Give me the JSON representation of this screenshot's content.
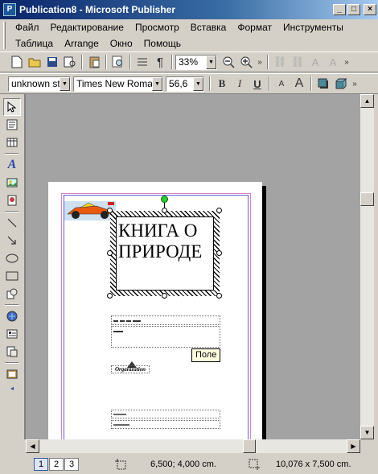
{
  "window": {
    "title": "Publication8 - Microsoft Publisher",
    "app_icon": "P",
    "controls": {
      "minimize": "_",
      "maximize": "□",
      "close": "×"
    }
  },
  "menu": {
    "row1": [
      "Файл",
      "Редактирование",
      "Просмотр",
      "Вставка",
      "Формат",
      "Инструменты"
    ],
    "row2": [
      "Таблица",
      "Arrange",
      "Окно",
      "Помощь"
    ]
  },
  "standard_toolbar": {
    "zoom": "33%"
  },
  "format_toolbar": {
    "style": "unknown sty",
    "font": "Times New Roman",
    "size": "56,6",
    "bold": "B",
    "italic": "I",
    "underline": "U",
    "shrink_font": "A",
    "grow_font": "A"
  },
  "document": {
    "title_text": "КНИГА О ПРИРОДЕ",
    "organization": "Organization",
    "tooltip": "Поле"
  },
  "statusbar": {
    "pages": [
      "1",
      "2",
      "3"
    ],
    "position": "6,500; 4,000 cm.",
    "size": "10,076 x  7,500 cm."
  },
  "colors": {
    "title_bar_start": "#0a246a",
    "title_bar_end": "#a6caf0",
    "workspace": "#a3a3a3",
    "guide_pink": "#e080c0",
    "guide_blue": "#6060e0"
  },
  "icons": {
    "new": "new-document-icon",
    "open": "open-folder-icon",
    "save": "save-icon",
    "print_preview": "print-preview-icon",
    "paste": "paste-icon",
    "find": "find-icon",
    "columns": "columns-icon",
    "pilcrow": "pilcrow-icon",
    "zoom_out": "zoom-out-icon",
    "zoom_in": "zoom-in-icon"
  }
}
